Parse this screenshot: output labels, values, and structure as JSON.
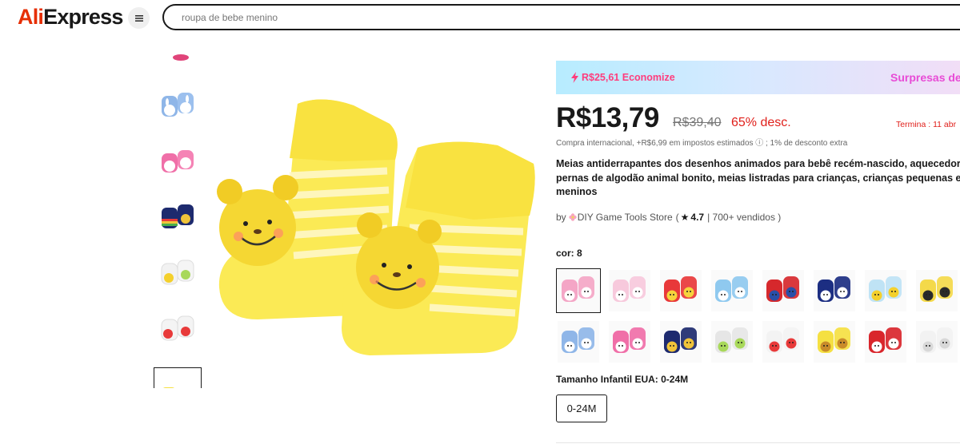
{
  "header": {
    "logo_prefix": "Ali",
    "logo_suffix": "Express",
    "search_placeholder": "roupa de bebe menino"
  },
  "gallery": {
    "thumbnails": [
      {
        "name": "thumb-pink-partial",
        "color": "#e0447a"
      },
      {
        "name": "thumb-blue-bunny",
        "color": "#8fb6e8"
      },
      {
        "name": "thumb-pink-bunny",
        "color": "#f06fa8"
      },
      {
        "name": "thumb-rainbow",
        "color": "#1d2a6e"
      },
      {
        "name": "thumb-white-bee",
        "color": "#f2f2f2"
      },
      {
        "name": "thumb-strawberry",
        "color": "#e83a3a"
      },
      {
        "name": "thumb-yellow-bear",
        "color": "#f5e042"
      }
    ]
  },
  "promo": {
    "savings": "R$25,61 Economize",
    "right_text": "Surpresas de"
  },
  "price": {
    "current": "R$13,79",
    "original": "R$39,40",
    "discount": "65% desc.",
    "ends": "Termina : 11 abr",
    "tax_note": "Compra internacional, +R$6,99 em impostos estimados ⓘ ; 1% de desconto extra"
  },
  "product": {
    "title_lines": [
      "Meias antiderrapantes dos desenhos animados para bebê recém-nascido, aquecedor",
      "pernas de algodão animal bonito, meias listradas para crianças, crianças pequenas e",
      "meninos"
    ]
  },
  "store": {
    "by": "by",
    "name": "DIY Game Tools Store",
    "open_paren": "(",
    "rating": "4.7",
    "sold": "| 700+ vendidos )"
  },
  "color": {
    "label": "cor: 8",
    "swatches": [
      {
        "main": "#f4a6c6",
        "accent": "#ffffff"
      },
      {
        "main": "#f7c9dc",
        "accent": "#ffffff"
      },
      {
        "main": "#e8383a",
        "accent": "#f6d33c"
      },
      {
        "main": "#8fc9ef",
        "accent": "#ffffff"
      },
      {
        "main": "#d6282c",
        "accent": "#2a4fa8"
      },
      {
        "main": "#1c2e82",
        "accent": "#ffffff"
      },
      {
        "main": "#bfe3f5",
        "accent": "#f4d02c"
      },
      {
        "main": "#f4d94a",
        "accent": "#2a2a2a"
      },
      {
        "main": "#8fb6e8",
        "accent": "#ffffff"
      },
      {
        "main": "#f06fa8",
        "accent": "#ffffff"
      },
      {
        "main": "#1d2a6e",
        "accent": "#f0c43a"
      },
      {
        "main": "#e6e6e6",
        "accent": "#a8d85a"
      },
      {
        "main": "#f3f3f3",
        "accent": "#e83a3a"
      },
      {
        "main": "#f5e042",
        "accent": "#c98b2a"
      },
      {
        "main": "#d9262c",
        "accent": "#ffffff"
      },
      {
        "main": "#f2f2f2",
        "accent": "#d8d8d8"
      }
    ]
  },
  "size": {
    "label": "Tamanho Infantil EUA: 0-24M",
    "option": "0-24M"
  },
  "colors": {
    "price_red": "#e0201b",
    "promo_pink": "#ff3d7d",
    "brand_red": "#e62e04"
  }
}
